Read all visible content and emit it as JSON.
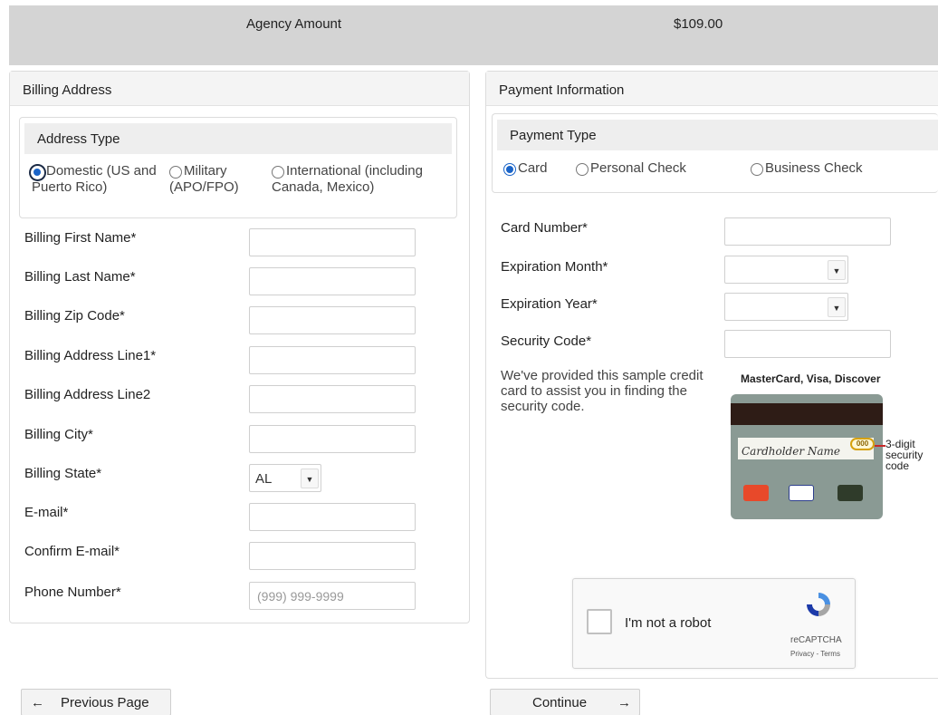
{
  "summary": {
    "label": "Agency Amount",
    "amount": "$109.00"
  },
  "billing": {
    "title": "Billing Address",
    "address_type": {
      "title": "Address Type",
      "options": [
        {
          "line1": "Domestic (US and",
          "line2": "Puerto Rico)",
          "selected": true
        },
        {
          "line1": "Military",
          "line2": "(APO/FPO)",
          "selected": false
        },
        {
          "line1": "International (including",
          "line2": "Canada, Mexico)",
          "selected": false
        }
      ]
    },
    "fields": [
      {
        "label": "Billing First Name*",
        "value": "",
        "placeholder": ""
      },
      {
        "label": "Billing Last Name*",
        "value": "",
        "placeholder": ""
      },
      {
        "label": "Billing Zip Code*",
        "value": "",
        "placeholder": ""
      },
      {
        "label": "Billing Address Line1*",
        "value": "",
        "placeholder": ""
      },
      {
        "label": "Billing Address Line2",
        "value": "",
        "placeholder": ""
      },
      {
        "label": "Billing City*",
        "value": "",
        "placeholder": ""
      },
      {
        "label": "Billing State*",
        "value": "AL",
        "placeholder": ""
      },
      {
        "label": "E-mail*",
        "value": "",
        "placeholder": ""
      },
      {
        "label": "Confirm E-mail*",
        "value": "",
        "placeholder": ""
      },
      {
        "label": "Phone Number*",
        "value": "",
        "placeholder": "(999) 999-9999"
      }
    ]
  },
  "payment": {
    "title": "Payment Information",
    "payment_type": {
      "title": "Payment Type",
      "options": [
        {
          "label": "Card",
          "selected": true
        },
        {
          "label": "Personal Check",
          "selected": false
        },
        {
          "label": "Business Check",
          "selected": false
        }
      ]
    },
    "fields": [
      {
        "label": "Card Number*",
        "value": ""
      },
      {
        "label": "Expiration Month*",
        "value": ""
      },
      {
        "label": "Expiration Year*",
        "value": ""
      },
      {
        "label": "Security Code*",
        "value": ""
      }
    ],
    "sample_text": "We've provided this sample credit card to assist you in finding the security code.",
    "card_brands": "MasterCard,  Visa,  Discover",
    "sample_card": {
      "cardholder": "Cardholder Name",
      "code": "000"
    },
    "security_note": "3-digit security code",
    "captcha": {
      "label": "I'm not a robot",
      "brand": "reCAPTCHA",
      "links": "Privacy - Terms"
    }
  },
  "buttons": {
    "previous": "Previous Page",
    "continue": "Continue"
  },
  "colors": {
    "accent": "#1a64c8",
    "header_bar": "#d4d4d4",
    "code_highlight": "#d6a10c"
  }
}
